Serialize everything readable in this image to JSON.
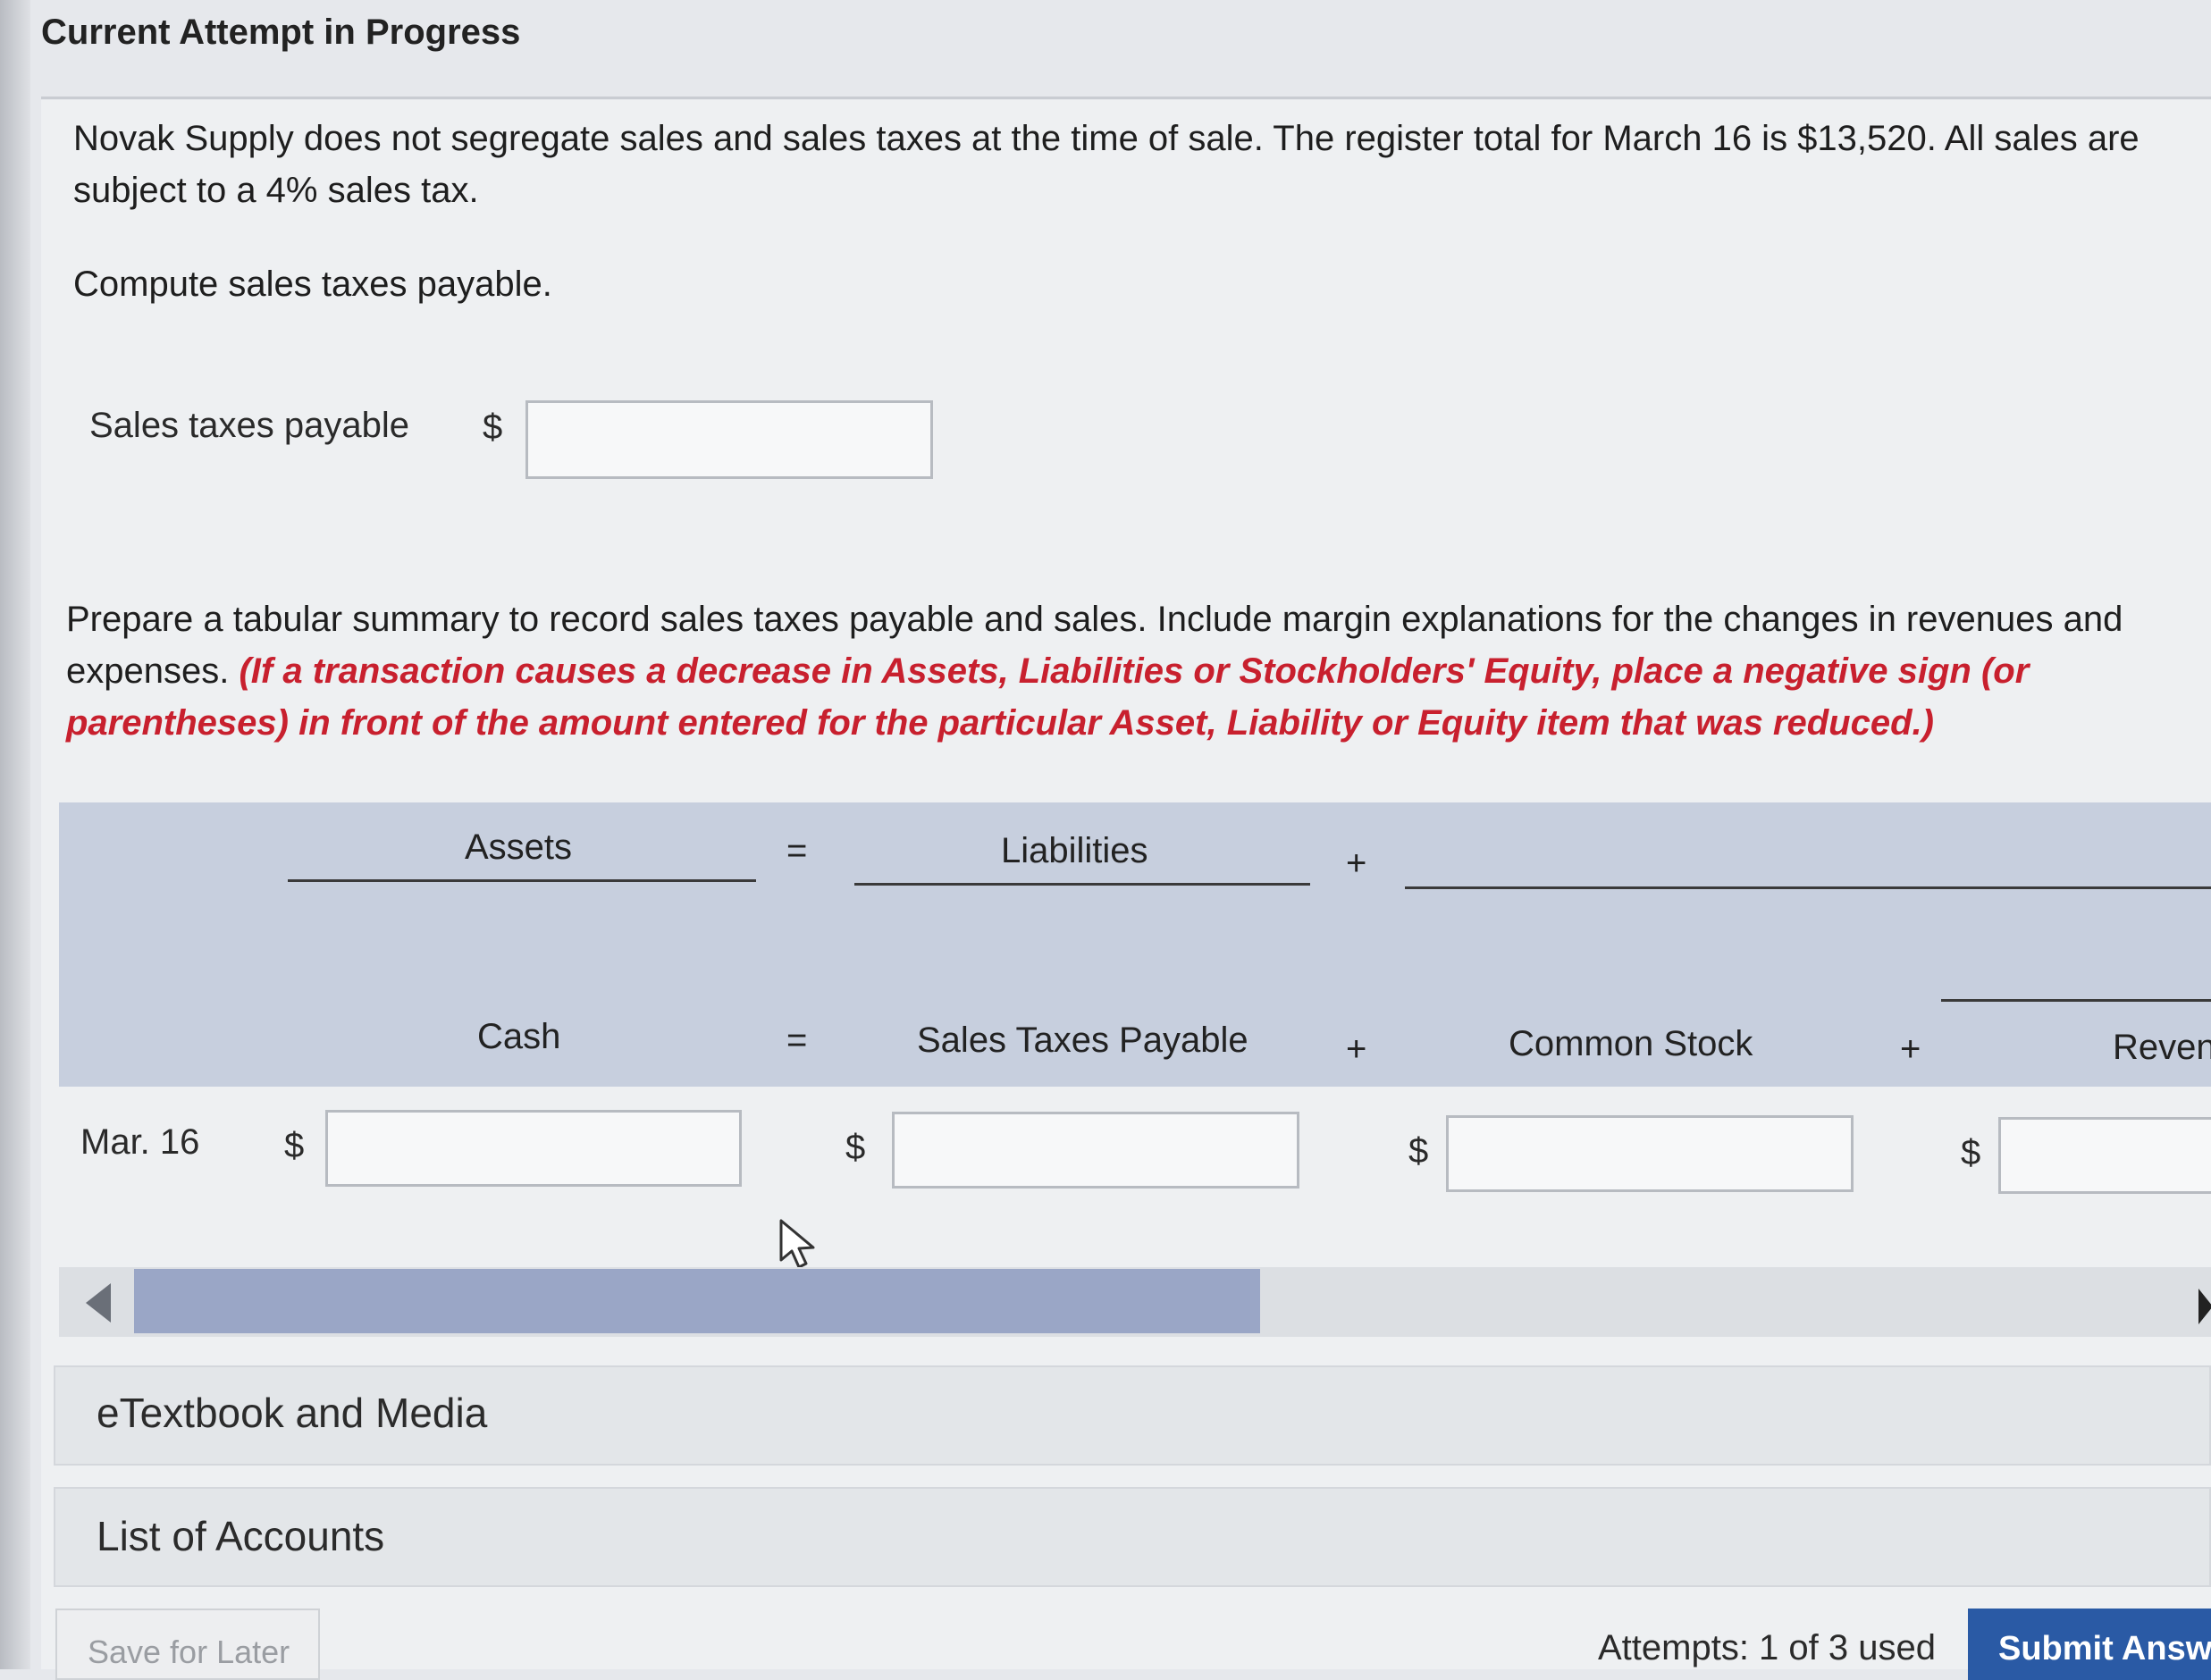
{
  "header": {
    "title": "Current Attempt in Progress"
  },
  "question": {
    "text": "Novak Supply does not segregate sales and sales taxes at the time of sale. The register total for March 16 is $13,520. All sales are subject to a 4% sales tax.",
    "instruction": "Compute sales taxes payable."
  },
  "sales_tax_field": {
    "label": "Sales taxes payable",
    "currency": "$",
    "value": ""
  },
  "tabular": {
    "instruction": "Prepare a tabular summary to record sales taxes payable and sales. Include margin explanations for the changes in revenues and expenses.",
    "note": "(If a transaction causes a decrease in Assets, Liabilities or Stockholders' Equity, place a negative sign (or parentheses) in front of the amount entered for the particular Asset, Liability or Equity item that was reduced.)",
    "group_headers": {
      "assets": "Assets",
      "equals": "=",
      "liabilities": "Liabilities",
      "plus": "+"
    },
    "columns": [
      {
        "label": "Cash"
      },
      {
        "label": "="
      },
      {
        "label": "Sales Taxes Payable"
      },
      {
        "label": "+"
      },
      {
        "label": "Common Stock"
      },
      {
        "label": "+"
      },
      {
        "label": "Reven"
      }
    ],
    "row": {
      "date": "Mar. 16",
      "currency": "$",
      "values": [
        "",
        "",
        "",
        ""
      ]
    }
  },
  "panels": {
    "etextbook": "eTextbook and Media",
    "accounts": "List of Accounts"
  },
  "footer": {
    "save_label": "Save for Later",
    "attempts": "Attempts: 1 of 3 used",
    "submit_label": "Submit Answer"
  },
  "colors": {
    "header_band": "#c7cfde",
    "scroll_thumb": "#9aa6c6",
    "note_red": "#c8202e",
    "submit_blue": "#2a5aa5"
  }
}
